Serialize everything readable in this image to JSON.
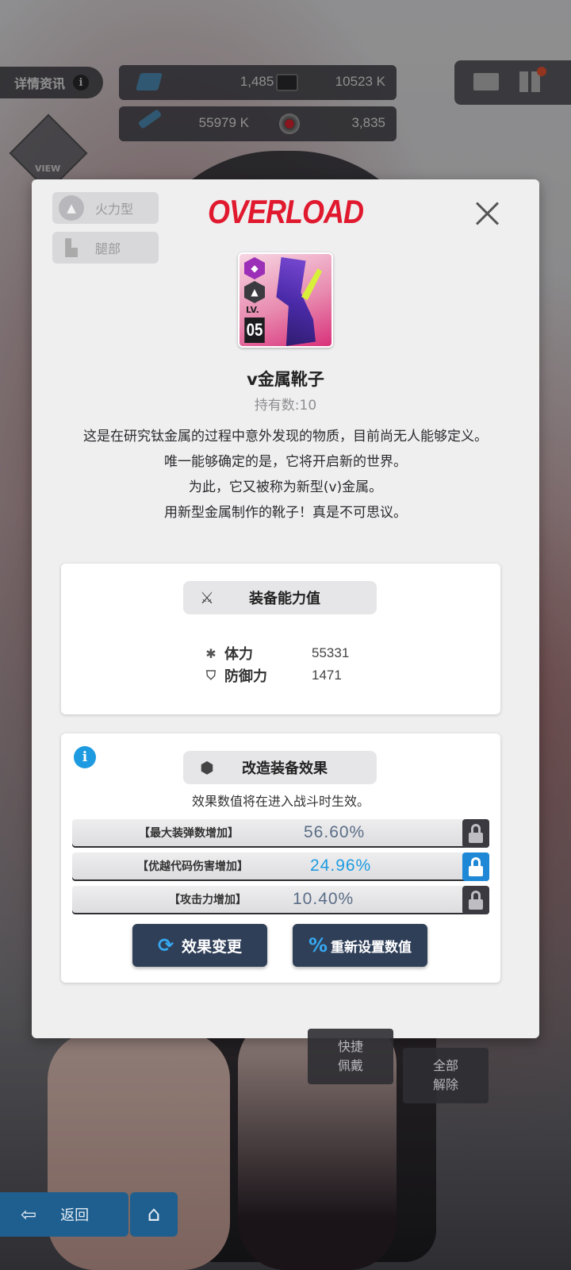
{
  "hud": {
    "detail_tab": "详情资讯",
    "detail_info": "i",
    "resources": [
      {
        "icon": "gem-icon",
        "value": "1,485 +"
      },
      {
        "icon": "credit-card-icon",
        "value": "10523 K"
      },
      {
        "icon": "battle-data-icon",
        "value": "55979 K"
      },
      {
        "icon": "core-dust-icon",
        "value": "3,835"
      }
    ],
    "view_label": "VIEW"
  },
  "modal": {
    "brand_logo": "OVERLOAD",
    "tags": [
      {
        "icon": "firepower-icon",
        "label": "火力型"
      },
      {
        "icon": "boot-icon",
        "label": "腿部"
      }
    ],
    "item": {
      "level_label": "LV.",
      "level": "05",
      "name": "v金属靴子",
      "count": "持有数:10",
      "description": [
        "这是在研究钛金属的过程中意外发现的物质，目前尚无人能够定义。",
        "唯一能够确定的是，它将开启新的世界。",
        "为此，它又被称为新型(v)金属。",
        "用新型金属制作的靴子！真是不可思议。"
      ]
    },
    "stats_panel": {
      "title": "装备能力值",
      "stats": [
        {
          "icon": "asterisk-icon",
          "label": "体力",
          "value": "55331"
        },
        {
          "icon": "shield-icon",
          "label": "防御力",
          "value": "1471"
        }
      ]
    },
    "effects_panel": {
      "title": "改造装备效果",
      "note": "效果数值将在进入战斗时生效。",
      "effects": [
        {
          "name": "【最大装弹数增加】",
          "value": "56.60%",
          "locked": false,
          "color": "#5a6d86"
        },
        {
          "name": "【优越代码伤害增加】",
          "value": "24.96%",
          "locked": true,
          "color": "#1e9be0"
        },
        {
          "name": "【攻击力增加】",
          "value": "10.40%",
          "locked": false,
          "color": "#5a6d86"
        }
      ],
      "change_button": "效果变更",
      "reset_button": "重新设置数值"
    }
  },
  "bottom": {
    "quick_equip": [
      "快捷",
      "佩戴"
    ],
    "unequip_all": [
      "全部",
      "解除"
    ],
    "back": "返回"
  },
  "colors": {
    "accent_blue": "#1e9be0",
    "brand_red": "#e0192e",
    "button_navy": "#2f3f58"
  }
}
